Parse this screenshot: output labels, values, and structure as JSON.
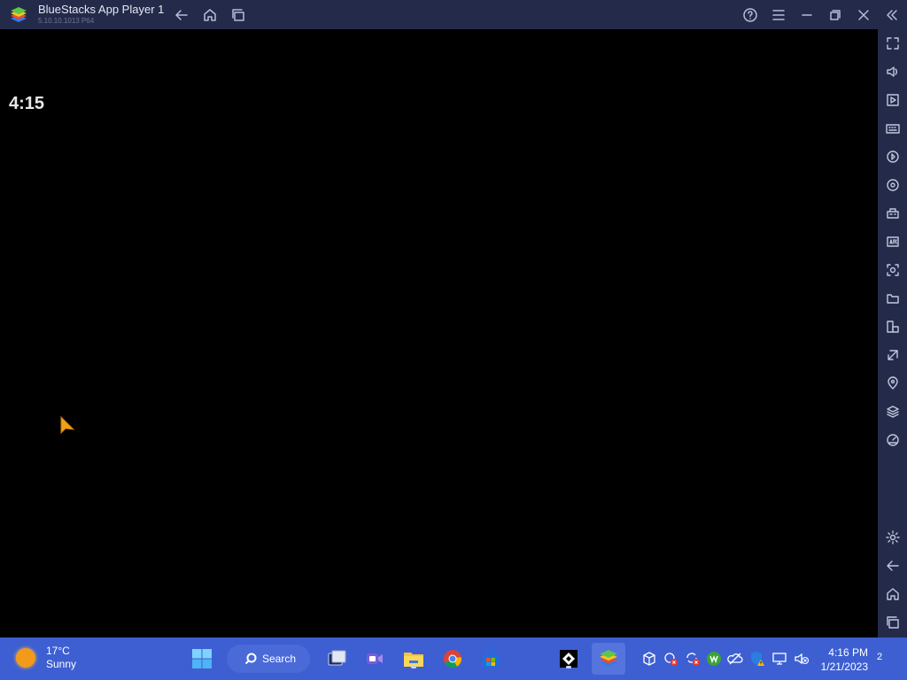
{
  "window": {
    "title": "BlueStacks App Player 1",
    "version": "5.10.10.1013 P64",
    "controls": [
      "back-icon",
      "home-icon",
      "recent-apps-icon",
      "help-icon",
      "menu-icon",
      "minimize-icon",
      "restore-icon",
      "close-icon",
      "collapse-sidebar-icon"
    ]
  },
  "screen": {
    "clock": "4:15"
  },
  "sidebar": {
    "items": [
      {
        "name": "fullscreen-icon"
      },
      {
        "name": "volume-icon"
      },
      {
        "name": "media-manager-icon"
      },
      {
        "name": "keyboard-controls-icon"
      },
      {
        "name": "macro-recorder-icon"
      },
      {
        "name": "sync-icon"
      },
      {
        "name": "game-controls-icon"
      },
      {
        "name": "install-apk-icon"
      },
      {
        "name": "screenshot-icon"
      },
      {
        "name": "folder-icon"
      },
      {
        "name": "multi-instance-icon"
      },
      {
        "name": "eco-mode-icon"
      },
      {
        "name": "location-icon"
      },
      {
        "name": "layers-icon"
      },
      {
        "name": "performance-icon"
      },
      {
        "name": "settings-icon"
      },
      {
        "name": "back-icon"
      },
      {
        "name": "home-icon"
      },
      {
        "name": "recent-apps-icon"
      }
    ]
  },
  "taskbar": {
    "weather": {
      "temp": "17°C",
      "condition": "Sunny"
    },
    "search_label": "Search",
    "clock": {
      "time": "4:16 PM",
      "date": "1/21/2023"
    },
    "notification_count": "2",
    "colors": {
      "background": "#3d5fd2",
      "accent": "#5574de"
    }
  }
}
